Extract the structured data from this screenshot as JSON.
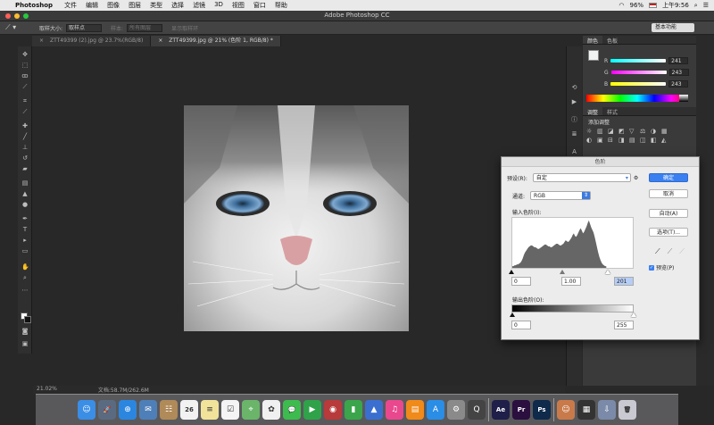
{
  "menubar": {
    "app_name": "Photoshop",
    "items": [
      "文件",
      "编辑",
      "图像",
      "图层",
      "类型",
      "选择",
      "滤镜",
      "3D",
      "视图",
      "窗口",
      "帮助"
    ],
    "battery": "96%",
    "time": "上午9:56"
  },
  "window": {
    "title": "Adobe Photoshop CC"
  },
  "options": {
    "sample_label": "取样大小:",
    "sample_value": "取样点",
    "sample2_label": "样本:",
    "sample2_value": "所有图层",
    "show_ring": "显示取样环",
    "workspace": "基本功能"
  },
  "tabs": [
    {
      "label": "ZTT49399 (2).jpg @ 23.7%(RGB/8)",
      "close": "×"
    },
    {
      "label": "ZTT49399.jpg @ 21% (色阶 1, RGB/8) *",
      "close": "×"
    }
  ],
  "status": {
    "zoom": "21.02%",
    "doc": "文档:58.7M/262.6M"
  },
  "color_panel": {
    "tabs": [
      "颜色",
      "色板"
    ],
    "channels": [
      {
        "name": "R",
        "value": "241",
        "color": "#ff3b3b"
      },
      {
        "name": "G",
        "value": "243",
        "color": "#3bff5a"
      },
      {
        "name": "B",
        "value": "243",
        "color": "#3b6bff"
      }
    ]
  },
  "adjust_panel": {
    "tabs": [
      "调整",
      "样式"
    ],
    "subtitle": "添加调整",
    "icons": [
      "☼",
      "▥",
      "◪",
      "◩",
      "▽",
      "⚖",
      "◑",
      "▦",
      "◐",
      "▣",
      "⊟",
      "◨",
      "▤",
      "◫",
      "◧",
      "◭"
    ]
  },
  "levels": {
    "title": "色阶",
    "preset_label": "预设(R):",
    "preset_value": "自定",
    "channel_label": "通道:",
    "channel_value": "RGB",
    "input_label": "输入色阶(I):",
    "input_black": "0",
    "input_gamma": "1.00",
    "input_white": "201",
    "output_label": "输出色阶(O):",
    "output_black": "0",
    "output_white": "255",
    "ok": "确定",
    "cancel": "取消",
    "auto": "自动(A)",
    "options": "选项(T)...",
    "preview": "预览(P)",
    "histogram": [
      2,
      2,
      3,
      3,
      4,
      4,
      5,
      6,
      8,
      11,
      15,
      18,
      20,
      22,
      24,
      25,
      26,
      26,
      25,
      24,
      24,
      23,
      22,
      22,
      23,
      24,
      25,
      26,
      27,
      27,
      26,
      25,
      25,
      24,
      24,
      25,
      26,
      27,
      28,
      28,
      27,
      26,
      26,
      27,
      28,
      30,
      32,
      31,
      30,
      31,
      33,
      35,
      38,
      40,
      37,
      36,
      38,
      41,
      44,
      46,
      43,
      40,
      42,
      45,
      48,
      52,
      55,
      51,
      47,
      44,
      41,
      36,
      30,
      24,
      18,
      13,
      9,
      6,
      4,
      3,
      2,
      2
    ]
  },
  "dock": {
    "apps": [
      {
        "name": "Finder",
        "glyph": "☺",
        "color": "#3a8ee6"
      },
      {
        "name": "Launchpad",
        "glyph": "🚀",
        "color": "#5a6a80"
      },
      {
        "name": "Safari",
        "glyph": "⊕",
        "color": "#2b86e0"
      },
      {
        "name": "Mail",
        "glyph": "✉",
        "color": "#4e7fb8"
      },
      {
        "name": "Contacts",
        "glyph": "☷",
        "color": "#b08a58"
      },
      {
        "name": "Calendar",
        "glyph": "26",
        "color": "#f2f2f2"
      },
      {
        "name": "Notes",
        "glyph": "≡",
        "color": "#f1e39a"
      },
      {
        "name": "Reminders",
        "glyph": "☑",
        "color": "#f4f4f4"
      },
      {
        "name": "Maps",
        "glyph": "⌖",
        "color": "#6ab56a"
      },
      {
        "name": "Photos",
        "glyph": "✿",
        "color": "#f0f0f0"
      },
      {
        "name": "Messages",
        "glyph": "💬",
        "color": "#3dbb4e"
      },
      {
        "name": "FaceTime",
        "glyph": "▶",
        "color": "#2fa24a"
      },
      {
        "name": "Photo Booth",
        "glyph": "◉",
        "color": "#b83a3a"
      },
      {
        "name": "Numbers",
        "glyph": "▮",
        "color": "#3aa54a"
      },
      {
        "name": "Keynote",
        "glyph": "▲",
        "color": "#3a6fd0"
      },
      {
        "name": "iTunes",
        "glyph": "♫",
        "color": "#e9488e"
      },
      {
        "name": "iBooks",
        "glyph": "▤",
        "color": "#f08a1a"
      },
      {
        "name": "App Store",
        "glyph": "A",
        "color": "#2a8de6"
      },
      {
        "name": "System Preferences",
        "glyph": "⚙",
        "color": "#8a8a8a"
      },
      {
        "name": "QuickTime",
        "glyph": "Q",
        "color": "#444"
      },
      {
        "name": "After Effects",
        "glyph": "Ae",
        "color": "#1f1f4a"
      },
      {
        "name": "Premiere",
        "glyph": "Pr",
        "color": "#2a0f3f"
      },
      {
        "name": "Photoshop",
        "glyph": "Ps",
        "color": "#0f2a4a"
      },
      {
        "name": "Photo",
        "glyph": "☺",
        "color": "#c97a4a"
      },
      {
        "name": "Window Thumb",
        "glyph": "▦",
        "color": "#333"
      },
      {
        "name": "Downloads",
        "glyph": "⇩",
        "color": "#7a8aa8"
      },
      {
        "name": "Trash",
        "glyph": "🗑",
        "color": "#c9c9d2"
      }
    ]
  },
  "colors": {
    "accent": "#3a80f0",
    "ui_dark": "#2b2b2b"
  }
}
